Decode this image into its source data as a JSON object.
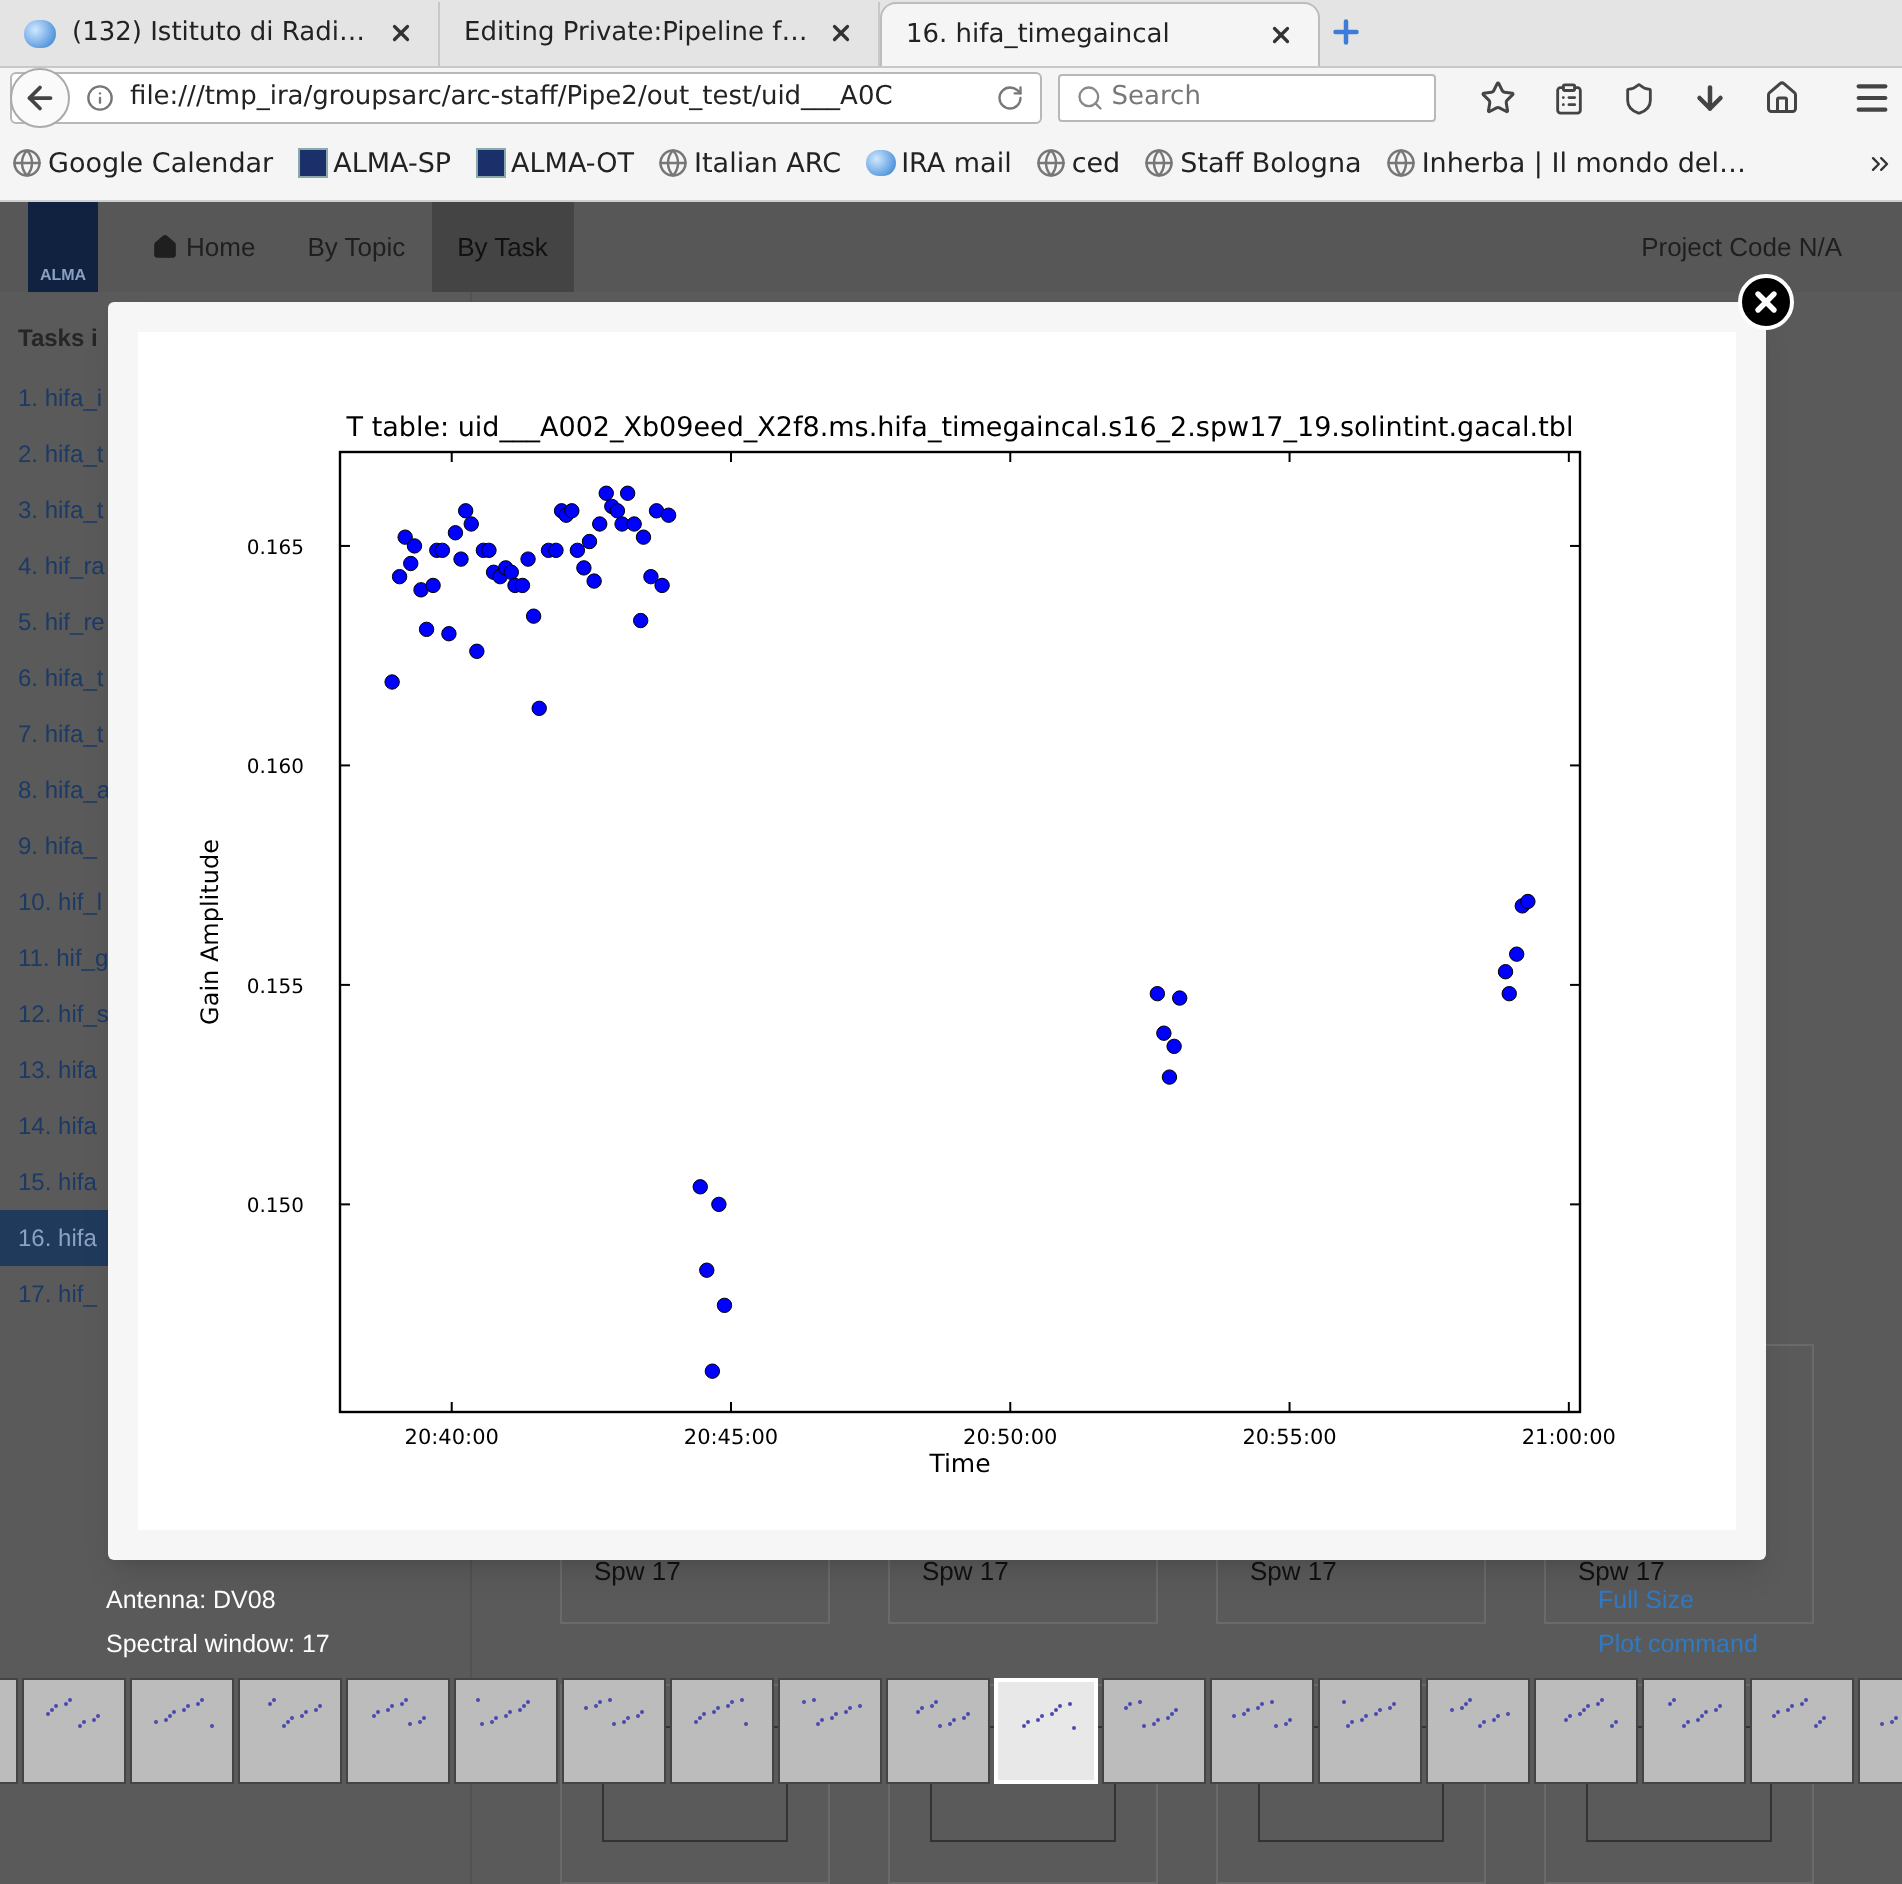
{
  "browser": {
    "tabs": [
      {
        "title": "(132) Istituto di Radi…",
        "kind": "favicon",
        "selected": false
      },
      {
        "title": "Editing Private:Pipeline f…",
        "kind": "plain",
        "selected": false
      },
      {
        "title": "16. hifa_timegaincal",
        "kind": "plain",
        "selected": true
      }
    ],
    "address": "file:///tmp_ira/groupsarc/arc-staff/Pipe2/out_test/uid___A0C",
    "search": {
      "placeholder": "Search"
    },
    "bookmarks": [
      {
        "label": "Google Calendar",
        "kind": "globe"
      },
      {
        "label": "ALMA-SP",
        "kind": "alma"
      },
      {
        "label": "ALMA-OT",
        "kind": "alma"
      },
      {
        "label": "Italian ARC",
        "kind": "globe"
      },
      {
        "label": "IRA mail",
        "kind": "ira"
      },
      {
        "label": "ced",
        "kind": "globe"
      },
      {
        "label": "Staff Bologna",
        "kind": "globe"
      },
      {
        "label": "Inherba | Il mondo del…",
        "kind": "globe"
      }
    ]
  },
  "site": {
    "logo": "ALMA",
    "nav": [
      {
        "label": "Home",
        "kind": "home",
        "selected": false
      },
      {
        "label": "By Topic",
        "kind": "plain",
        "selected": false
      },
      {
        "label": "By Task",
        "kind": "plain",
        "selected": true
      }
    ],
    "project_code": "Project Code N/A"
  },
  "sidebar": {
    "title": "Tasks i",
    "items": [
      {
        "label": "1. hifa_i",
        "selected": false
      },
      {
        "label": "2. hifa_t",
        "selected": false
      },
      {
        "label": "3. hifa_t",
        "selected": false
      },
      {
        "label": "4. hif_ra",
        "selected": false
      },
      {
        "label": "5. hif_re",
        "selected": false
      },
      {
        "label": "6. hifa_t",
        "selected": false
      },
      {
        "label": "7. hifa_t",
        "selected": false
      },
      {
        "label": "8. hifa_a",
        "selected": false
      },
      {
        "label": "9. hifa_",
        "selected": false
      },
      {
        "label": "10. hif_l",
        "selected": false
      },
      {
        "label": "11. hif_g",
        "selected": false
      },
      {
        "label": "12. hif_s",
        "selected": false
      },
      {
        "label": "13. hifa",
        "selected": false
      },
      {
        "label": "14. hifa",
        "selected": false
      },
      {
        "label": "15. hifa",
        "selected": false
      },
      {
        "label": "16. hifa",
        "selected": true
      },
      {
        "label": "17. hif_",
        "selected": false
      }
    ]
  },
  "cards": [
    {
      "label": "Spw 17"
    },
    {
      "label": "Spw 17"
    },
    {
      "label": "Spw 17"
    },
    {
      "label": "Spw 17"
    }
  ],
  "lightbox": {
    "chart_data": {
      "type": "scatter",
      "title": "T table: uid___A002_Xb09eed_X2f8.ms.hifa_timegaincal.s16_2.spw17_19.solintint.gacal.tbl",
      "xlabel": "Time",
      "ylabel": "Gain Amplitude",
      "series": [
        {
          "color": "#0000ff",
          "x": [
            74336,
            74344,
            74350,
            74356,
            74360,
            74367,
            74373,
            74380,
            74384,
            74390,
            74397,
            74404,
            74410,
            74415,
            74421,
            74427,
            74434,
            74440,
            74445,
            74452,
            74458,
            74464,
            74468,
            74476,
            74482,
            74488,
            74494,
            74504,
            74512,
            74518,
            74523,
            74529,
            74535,
            74542,
            74548,
            74553,
            74559,
            74566,
            74572,
            74578,
            74583,
            74589,
            74596,
            74603,
            74606,
            74614,
            74620,
            74626,
            74633,
            74667,
            74687,
            74674,
            74693,
            74680,
            75158,
            75182,
            75165,
            75176,
            75171,
            75532,
            75536,
            75544,
            75550,
            75556
          ],
          "values": [
            0.1619,
            0.1643,
            0.1652,
            0.1646,
            0.165,
            0.164,
            0.1631,
            0.1641,
            0.1649,
            0.1649,
            0.163,
            0.1653,
            0.1647,
            0.1658,
            0.1655,
            0.1626,
            0.1649,
            0.1649,
            0.1644,
            0.1643,
            0.1645,
            0.1644,
            0.1641,
            0.1641,
            0.1647,
            0.1634,
            0.1613,
            0.1649,
            0.1649,
            0.1658,
            0.1657,
            0.1658,
            0.1649,
            0.1645,
            0.1651,
            0.1642,
            0.1655,
            0.1662,
            0.1659,
            0.1658,
            0.1655,
            0.1662,
            0.1655,
            0.1633,
            0.1652,
            0.1643,
            0.1658,
            0.1641,
            0.1657,
            0.1504,
            0.15,
            0.1485,
            0.1477,
            0.1462,
            0.1548,
            0.1547,
            0.1539,
            0.1536,
            0.1529,
            0.1553,
            0.1548,
            0.1557,
            0.1568,
            0.1569
          ]
        }
      ],
      "xlim": [
        74280,
        75612
      ],
      "ylim": [
        0.14527,
        0.16714
      ],
      "xticks": [
        {
          "value": 74400,
          "label": "20:40:00"
        },
        {
          "value": 74700,
          "label": "20:45:00"
        },
        {
          "value": 75000,
          "label": "20:50:00"
        },
        {
          "value": 75300,
          "label": "20:55:00"
        },
        {
          "value": 75600,
          "label": "21:00:00"
        }
      ],
      "yticks": [
        {
          "value": 0.15,
          "label": "0.150"
        },
        {
          "value": 0.155,
          "label": "0.155"
        },
        {
          "value": 0.16,
          "label": "0.160"
        },
        {
          "value": 0.165,
          "label": "0.165"
        }
      ]
    },
    "caption": [
      "Antenna: DV08",
      "Spectral window: 17"
    ],
    "links": [
      "Full Size",
      "Plot command"
    ],
    "thumbnails": [
      {
        "selected": false
      },
      {
        "selected": false
      },
      {
        "selected": false
      },
      {
        "selected": false
      },
      {
        "selected": false
      },
      {
        "selected": false
      },
      {
        "selected": false
      },
      {
        "selected": false
      },
      {
        "selected": false
      },
      {
        "selected": false
      },
      {
        "selected": true
      },
      {
        "selected": false
      },
      {
        "selected": false
      },
      {
        "selected": false
      },
      {
        "selected": false
      },
      {
        "selected": false
      },
      {
        "selected": false
      },
      {
        "selected": false
      },
      {
        "selected": false
      }
    ]
  }
}
